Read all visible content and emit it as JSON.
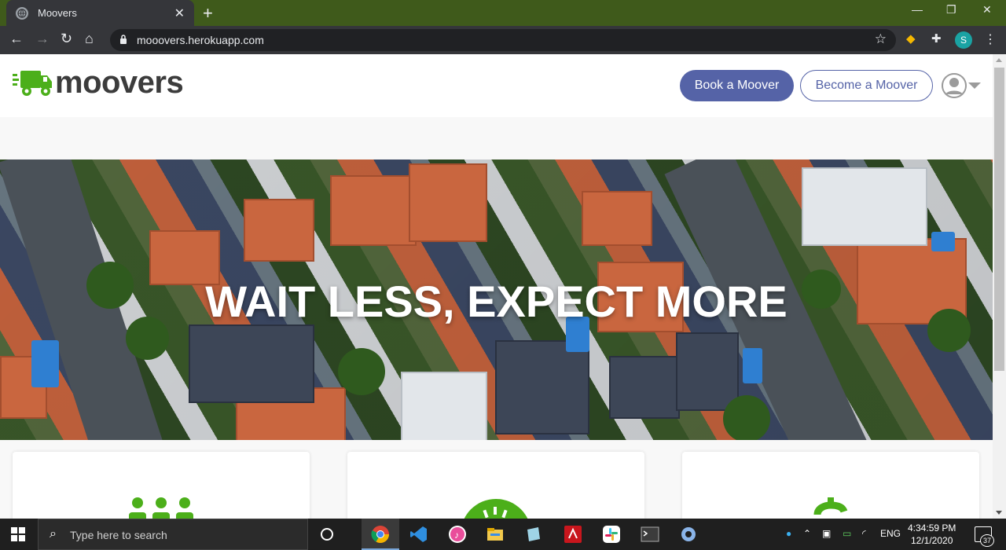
{
  "browser": {
    "tab_title": "Moovers",
    "tab_close": "✕",
    "new_tab": "+",
    "window_controls": {
      "minimize": "—",
      "restore": "❐",
      "close": "✕"
    },
    "url": "mooovers.herokuapp.com",
    "profile_initial": "S"
  },
  "site": {
    "logo_text": "moovers",
    "brand_green": "#4caf1a",
    "accent": "#5563a7",
    "nav": {
      "book_label": "Book a Moover",
      "become_label": "Become a Moover"
    },
    "hero_title": "WAIT LESS, EXPECT MORE",
    "cards": [
      {
        "icon": "people-icon"
      },
      {
        "icon": "speed-icon"
      },
      {
        "icon": "dollar-icon"
      }
    ]
  },
  "taskbar": {
    "search_placeholder": "Type here to search",
    "language": "ENG",
    "time": "4:34:59 PM",
    "date": "12/1/2020",
    "notification_count": "37"
  }
}
